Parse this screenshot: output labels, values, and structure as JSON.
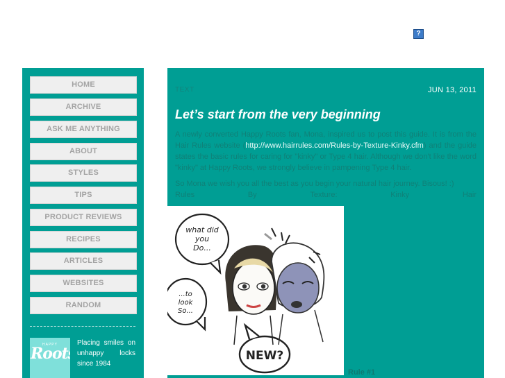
{
  "header": {
    "help_icon_label": "?"
  },
  "sidebar": {
    "nav": [
      "HOME",
      "ARCHIVE",
      "ASK ME ANYTHING",
      "ABOUT",
      "STYLES",
      "TIPS",
      "PRODUCT REVIEWS",
      "RECIPES",
      "ARTICLES",
      "WEBSITES",
      "RANDOM"
    ],
    "logo": {
      "small_text": "HAPPY",
      "word": "Roots"
    },
    "tagline": "Placing smiles on unhappy locks since 1984"
  },
  "post": {
    "type": "TEXT",
    "date": "JUN 13, 2011",
    "title": "Let’s start from the very beginning",
    "para1_a": "A newly converted Happy Roots fan, Mona, inspired us to post this guide. It is from the Hair Rules website (",
    "link": "http://www.hairrules.com/Rules-by-Texture-Kinky.cfm",
    "para1_b": ") and the guide states the basic rules for caring for \"kinky\" or Type 4 hair. Although we don't like the word \"kinky\" at Happy Roots, we strongly believe in pampening Type 4 hair.",
    "para2": "So Mona we wish you all the best as you begin your natural hair journey. Bisous! :)",
    "rules_line": [
      "Rules",
      "By",
      "Texture:",
      "Kinky",
      "Hair"
    ],
    "bubbles": [
      "what did you Do...",
      "...to look So...",
      "NEW?"
    ],
    "rule_label": "Rule #1"
  }
}
